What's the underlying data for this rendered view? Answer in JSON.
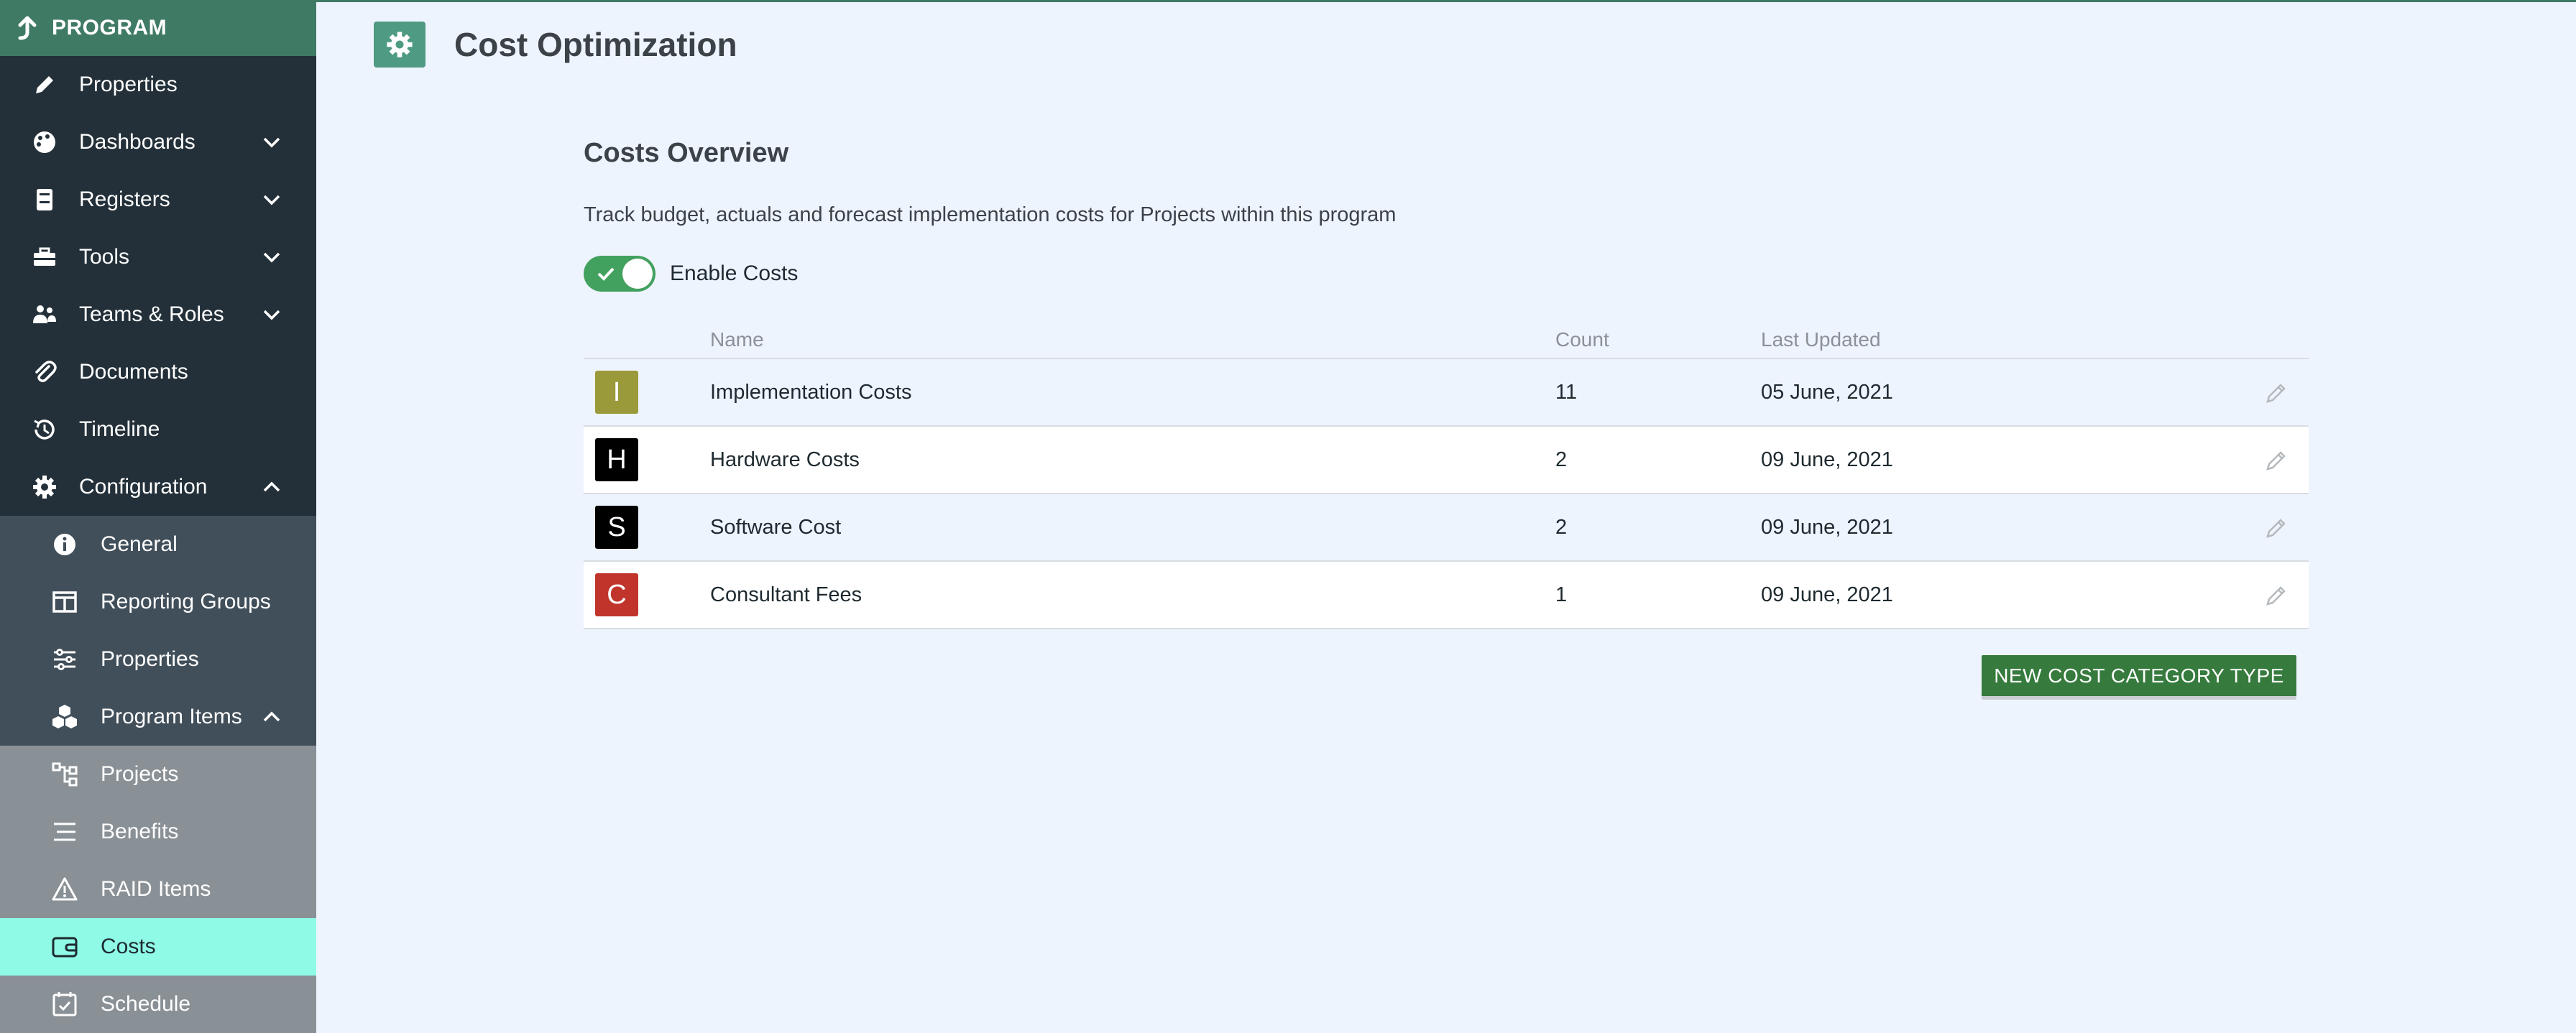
{
  "sidebar": {
    "header": "PROGRAM",
    "items": [
      {
        "label": "Properties",
        "icon": "pencil-icon"
      },
      {
        "label": "Dashboards",
        "icon": "palette-icon"
      },
      {
        "label": "Registers",
        "icon": "registers-icon"
      },
      {
        "label": "Tools",
        "icon": "toolbox-icon"
      },
      {
        "label": "Teams & Roles",
        "icon": "users-icon"
      },
      {
        "label": "Documents",
        "icon": "paperclip-icon"
      },
      {
        "label": "Timeline",
        "icon": "history-icon"
      },
      {
        "label": "Configuration",
        "icon": "gear-icon"
      },
      {
        "label": "General",
        "icon": "info-icon"
      },
      {
        "label": "Reporting Groups",
        "icon": "columns-icon"
      },
      {
        "label": "Properties",
        "icon": "sliders-icon"
      },
      {
        "label": "Program Items",
        "icon": "cubes-icon"
      },
      {
        "label": "Projects",
        "icon": "hierarchy-icon"
      },
      {
        "label": "Benefits",
        "icon": "lines-icon"
      },
      {
        "label": "RAID Items",
        "icon": "warning-icon"
      },
      {
        "label": "Costs",
        "icon": "wallet-icon"
      },
      {
        "label": "Schedule",
        "icon": "calendar-check-icon"
      }
    ]
  },
  "page": {
    "title": "Cost Optimization",
    "section_title": "Costs Overview",
    "description": "Track budget, actuals and forecast implementation costs for Projects within this program",
    "toggle_label": "Enable Costs",
    "toggle_on": true
  },
  "table": {
    "headers": [
      "Name",
      "Count",
      "Last Updated"
    ],
    "rows": [
      {
        "letter": "I",
        "color": "#9a9a3a",
        "name": "Implementation Costs",
        "count": "11",
        "date": "05 June, 2021"
      },
      {
        "letter": "H",
        "color": "#000000",
        "name": "Hardware Costs",
        "count": "2",
        "date": "09 June, 2021"
      },
      {
        "letter": "S",
        "color": "#000000",
        "name": "Software Cost",
        "count": "2",
        "date": "09 June, 2021"
      },
      {
        "letter": "C",
        "color": "#c0342b",
        "name": "Consultant Fees",
        "count": "1",
        "date": "09 June, 2021"
      }
    ]
  },
  "button": {
    "new_label": "NEW COST CATEGORY TYPE"
  },
  "colors": {
    "accent": "#3f7a65",
    "active_nav": "#8ffbe6",
    "button": "#367b3d",
    "toggle": "#43a15f"
  }
}
